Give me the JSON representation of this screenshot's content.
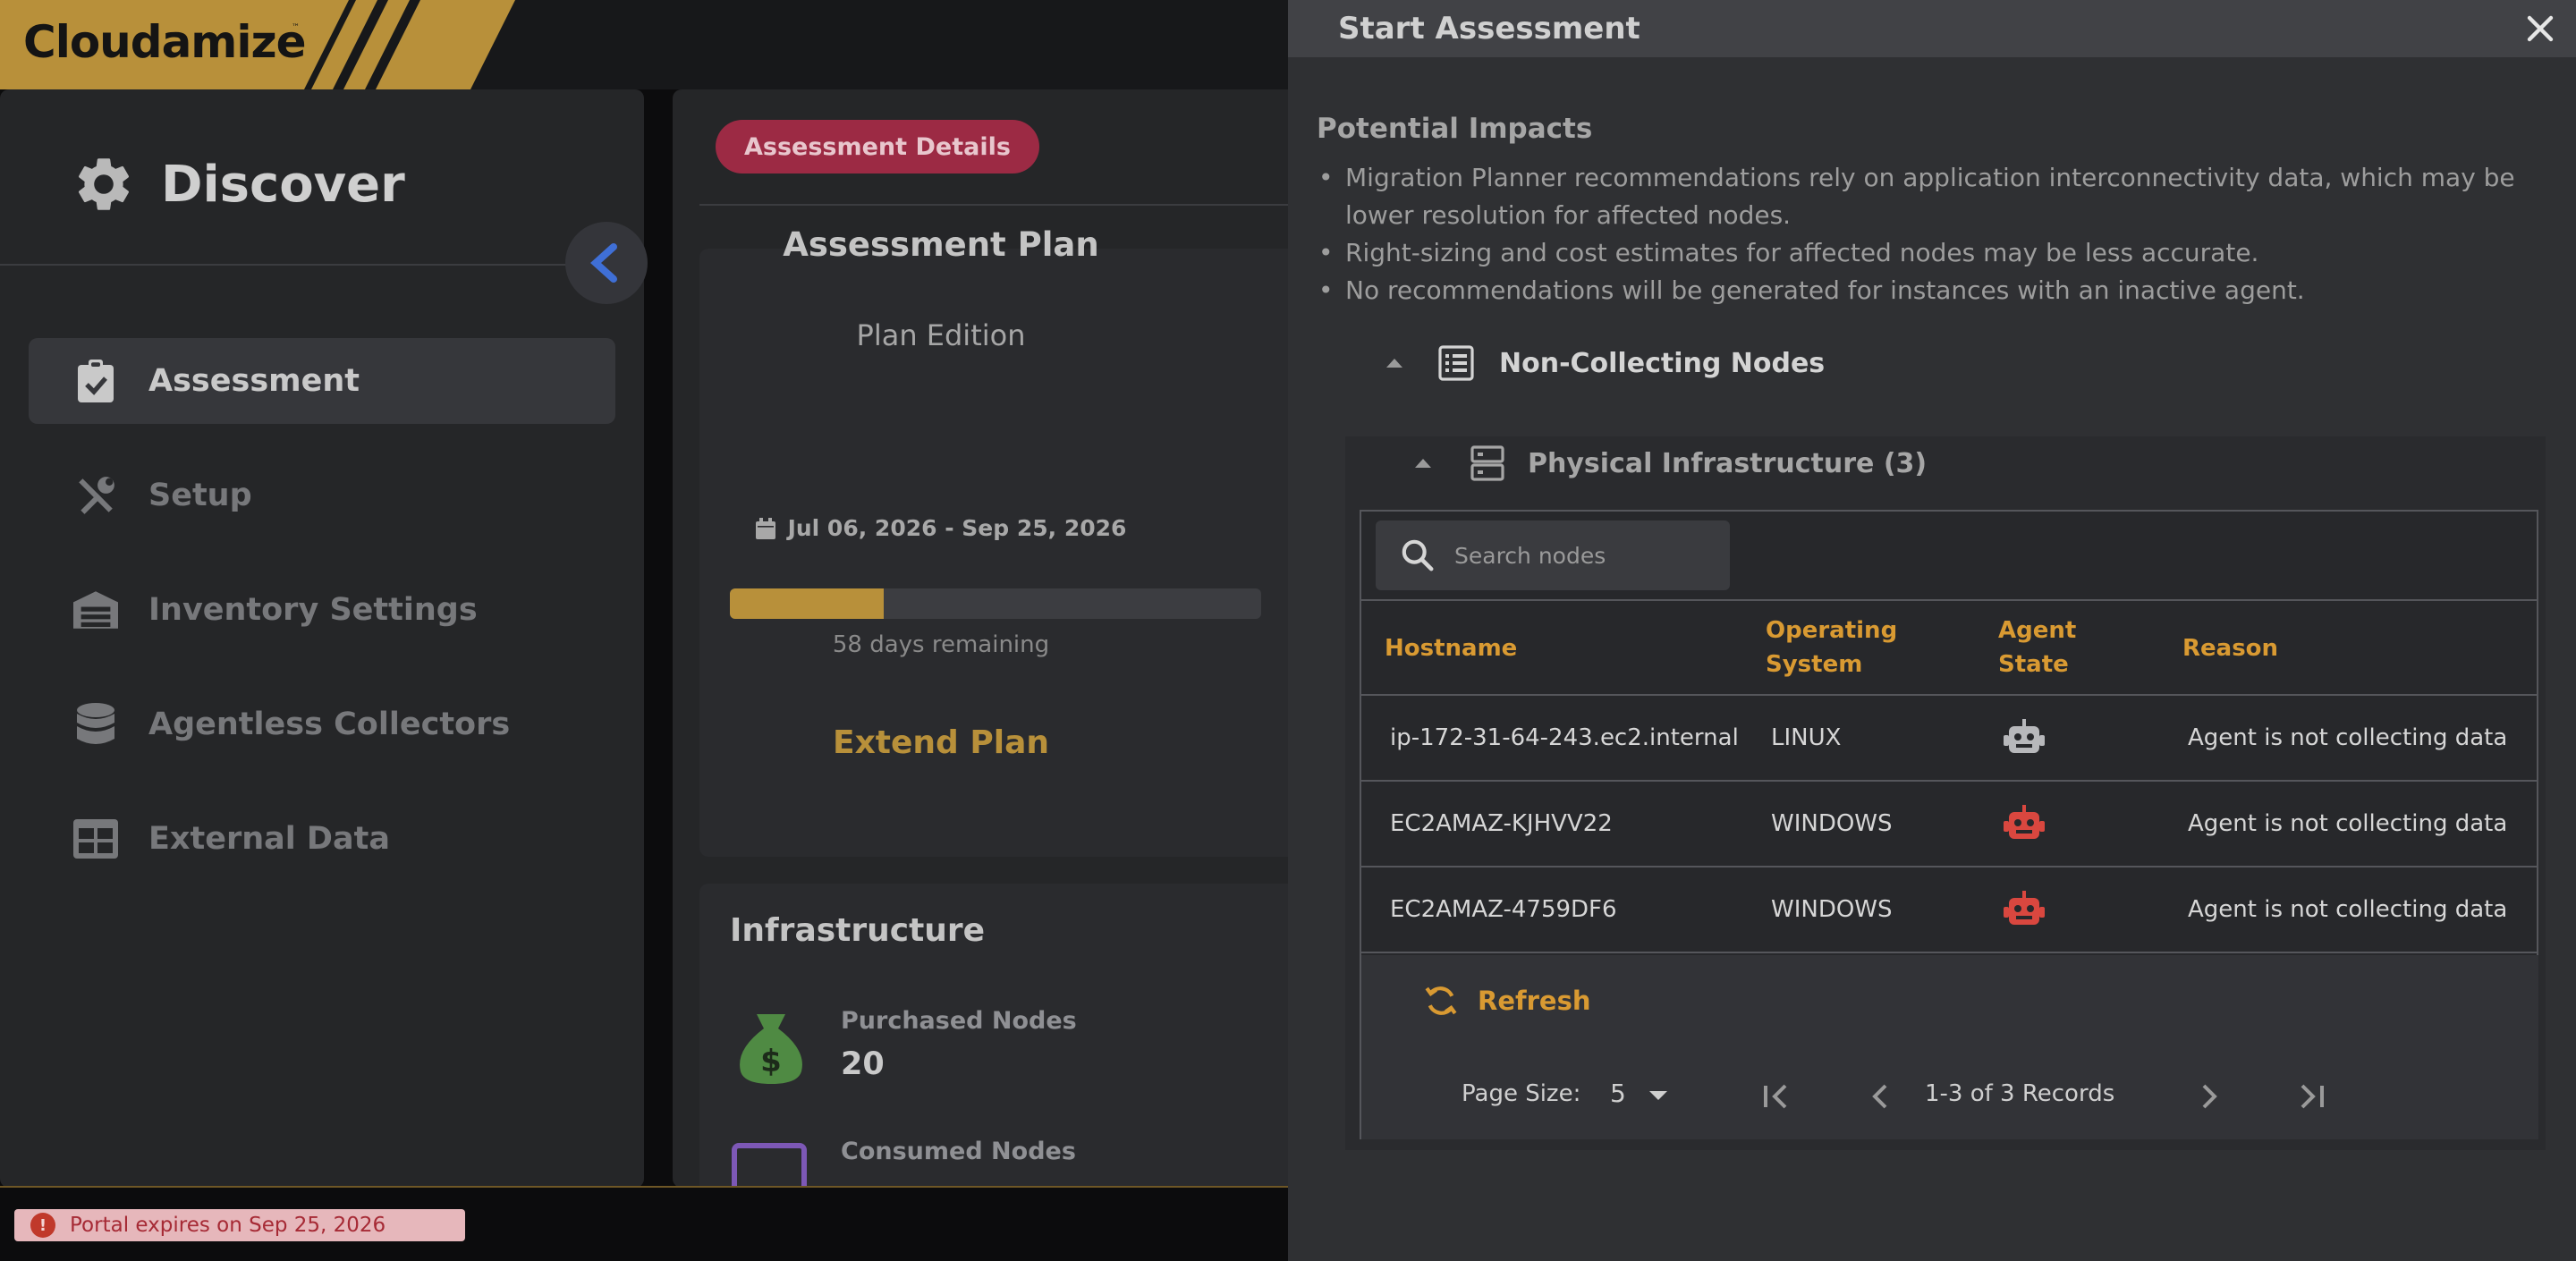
{
  "app": {
    "logo": "Cloudamize",
    "logo_tm": "™",
    "brand_color": "#b8903a"
  },
  "sidebar": {
    "title": "Discover",
    "items": [
      {
        "label": "Assessment",
        "icon": "clipboard-check-icon",
        "active": true
      },
      {
        "label": "Setup",
        "icon": "tools-icon",
        "active": false
      },
      {
        "label": "Inventory Settings",
        "icon": "warehouse-icon",
        "active": false
      },
      {
        "label": "Agentless Collectors",
        "icon": "database-icon",
        "active": false
      },
      {
        "label": "External Data",
        "icon": "table-icon",
        "active": false
      }
    ]
  },
  "details": {
    "tab_label": "Assessment Details",
    "plan_title": "Assessment Plan",
    "plan_edition": "Plan Edition",
    "date_range": "Jul 06, 2026 - Sep 25, 2026",
    "progress_fraction": 0.29,
    "days_remaining": "58 days remaining",
    "extend_label": "Extend Plan",
    "infrastructure_title": "Infrastructure",
    "purchased_label": "Purchased Nodes",
    "purchased_value": "20",
    "consumed_label": "Consumed Nodes"
  },
  "status": {
    "expiry_text": "Portal expires on Sep 25, 2026",
    "expiry_icon": "!"
  },
  "modal": {
    "title": "Start Assessment",
    "impacts_title": "Potential Impacts",
    "impacts": [
      "Migration Planner recommendations rely on application interconnectivity data, which may be lower resolution for affected nodes.",
      "Right-sizing and cost estimates for affected nodes may be less accurate.",
      "No recommendations will be generated for instances with an inactive agent."
    ],
    "section_label": "Non-Collecting Nodes",
    "subsection_label": "Physical Infrastructure (3)",
    "search_placeholder": "Search nodes",
    "columns": {
      "hostname": "Hostname",
      "os_line1": "Operating",
      "os_line2": "System",
      "agent_line1": "Agent",
      "agent_line2": "State",
      "reason": "Reason"
    },
    "rows": [
      {
        "hostname": "ip-172-31-64-243.ec2.internal",
        "os": "LINUX",
        "agent_state": "inactive",
        "agent_color": "#b7b8bb",
        "reason": "Agent is not collecting data"
      },
      {
        "hostname": "EC2AMAZ-KJHVV22",
        "os": "WINDOWS",
        "agent_state": "error",
        "agent_color": "#d9473f",
        "reason": "Agent is not collecting data"
      },
      {
        "hostname": "EC2AMAZ-4759DF6",
        "os": "WINDOWS",
        "agent_state": "error",
        "agent_color": "#d9473f",
        "reason": "Agent is not collecting data"
      }
    ],
    "refresh_label": "Refresh",
    "page_size_label": "Page Size:",
    "page_size_value": "5",
    "records_label": "1-3 of 3 Records"
  }
}
